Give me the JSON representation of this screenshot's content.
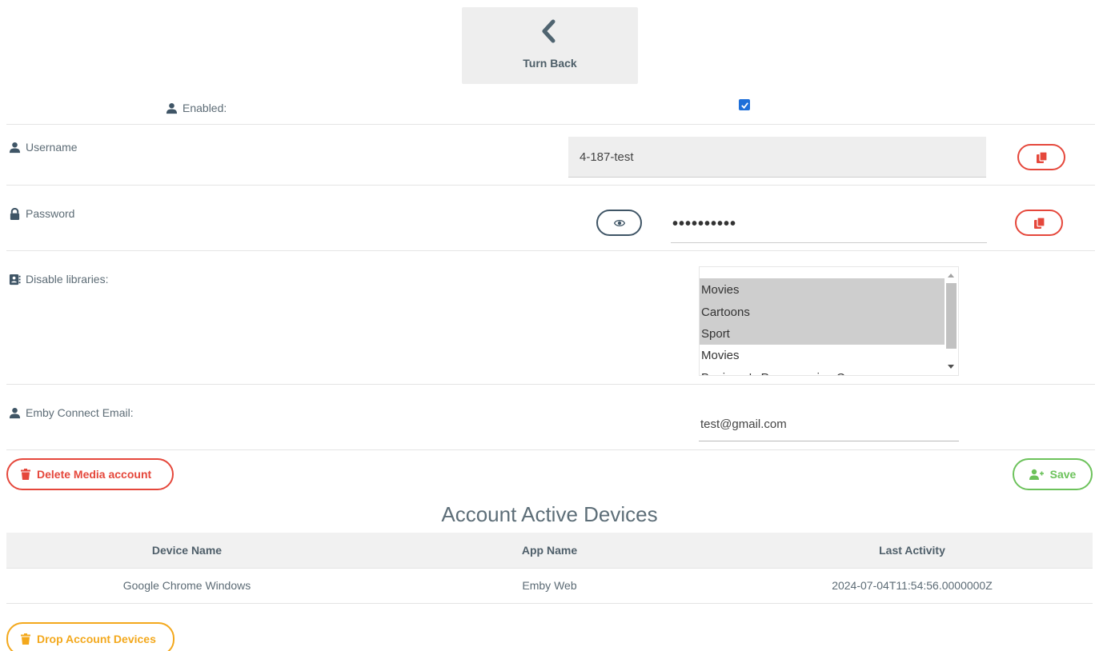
{
  "back": {
    "label": "Turn Back"
  },
  "form": {
    "enabled": {
      "label": "Enabled:",
      "checked": true
    },
    "username": {
      "label": "Username",
      "value": "4-187-test"
    },
    "password": {
      "label": "Password",
      "masked_value": "••••••••••"
    },
    "disable_libraries": {
      "label": "Disable libraries:",
      "options": [
        {
          "text": "Movies",
          "selected": true
        },
        {
          "text": "Cartoons",
          "selected": true
        },
        {
          "text": "Sport",
          "selected": true
        },
        {
          "text": "Movies",
          "selected": false
        },
        {
          "text": "Beginner's Programming Course",
          "selected": false
        }
      ]
    },
    "emby_email": {
      "label": "Emby Connect Email:",
      "value": "test@gmail.com"
    }
  },
  "actions": {
    "delete_label": "Delete Media account",
    "save_label": "Save",
    "drop_label": "Drop Account Devices"
  },
  "devices": {
    "title": "Account Active Devices",
    "columns": [
      "Device Name",
      "App Name",
      "Last Activity"
    ],
    "rows": [
      [
        "Google Chrome Windows",
        "Emby Web",
        "2024-07-04T11:54:56.0000000Z"
      ]
    ]
  },
  "colors": {
    "danger": "#e5473b",
    "success": "#6cc25b",
    "warning": "#f3a81c",
    "primary": "#3f5566",
    "checkbox": "#1e6fd9"
  }
}
